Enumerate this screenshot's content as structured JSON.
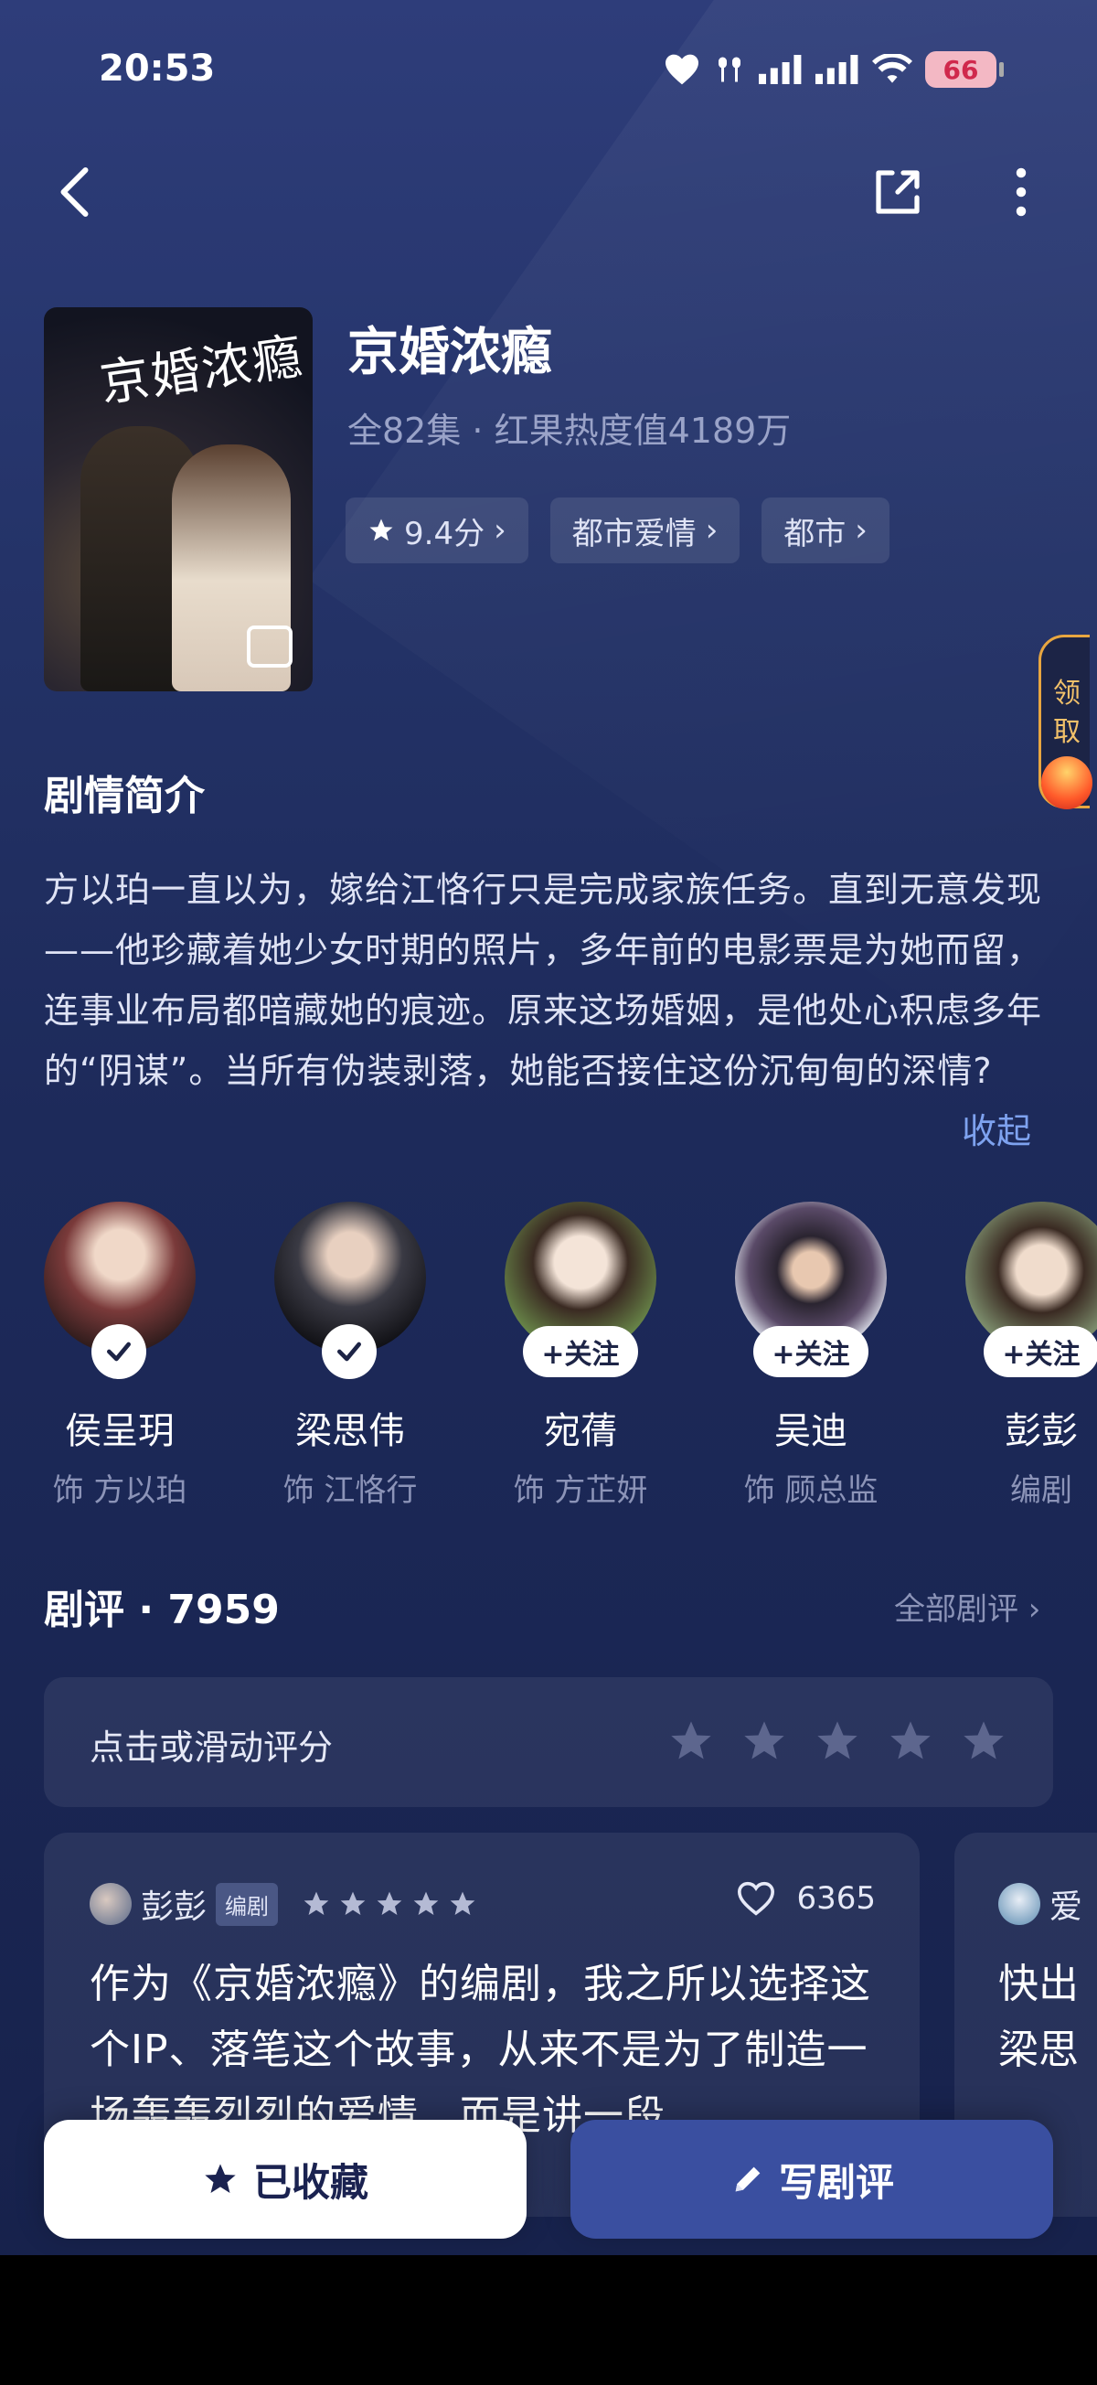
{
  "status_bar": {
    "time": "20:53",
    "battery": "66"
  },
  "drama": {
    "title": "京婚浓瘾",
    "subtitle": "全82集 · 红果热度值4189万",
    "poster_title": "京婚浓瘾",
    "tags": [
      {
        "label": "9.4分",
        "icon": "star-icon"
      },
      {
        "label": "都市爱情"
      },
      {
        "label": "都市"
      }
    ]
  },
  "reward_float": {
    "line1": "领",
    "line2": "取"
  },
  "synopsis": {
    "title": "剧情简介",
    "text": "方以珀一直以为，嫁给江恪行只是完成家族任务。直到无意发现——他珍藏着她少女时期的照片，多年前的电影票是为她而留，连事业布局都暗藏她的痕迹。原来这场婚姻，是他处心积虑多年的“阴谋”。当所有伪装剥落，她能否接住这份沉甸甸的深情?",
    "collapse_label": "收起"
  },
  "cast": [
    {
      "name": "侯呈玥",
      "role": "饰 方以珀",
      "followed": true,
      "colors": [
        "#7a3a3a",
        "#2a1a1a"
      ]
    },
    {
      "name": "梁思伟",
      "role": "饰 江恪行",
      "followed": true,
      "colors": [
        "#3a3a44",
        "#0e0e12"
      ]
    },
    {
      "name": "宛蒨",
      "role": "饰 方芷妍",
      "followed": false,
      "follow_label": "+关注",
      "colors": [
        "#6a8a4a",
        "#e8d8c8"
      ]
    },
    {
      "name": "吴迪",
      "role": "饰 顾总监",
      "followed": false,
      "follow_label": "+关注",
      "colors": [
        "#e0e4ee",
        "#3a3048"
      ]
    },
    {
      "name": "彭彭",
      "role": "编剧",
      "followed": false,
      "follow_label": "+关注",
      "colors": [
        "#7a8a6a",
        "#d8c8b8"
      ]
    }
  ],
  "reviews": {
    "title": "剧评 · 7959",
    "all_label": "全部剧评 ›",
    "rate_prompt": "点击或滑动评分",
    "items": [
      {
        "user": "彭彭",
        "badge": "编剧",
        "likes": "6365",
        "text": "作为《京婚浓瘾》的编剧，我之所以选择这个IP、落笔这个故事，从来不是为了制造一场轰轰烈烈的爱情，而是讲一段"
      },
      {
        "user": "爱",
        "line1": "快出",
        "line2": "梁思"
      }
    ]
  },
  "actions": {
    "favorite_label": "已收藏",
    "write_label": "写剧评"
  },
  "colors": {
    "accent": "#7ea2ef",
    "background": "#243368",
    "write_button": "#3a4fa0"
  }
}
